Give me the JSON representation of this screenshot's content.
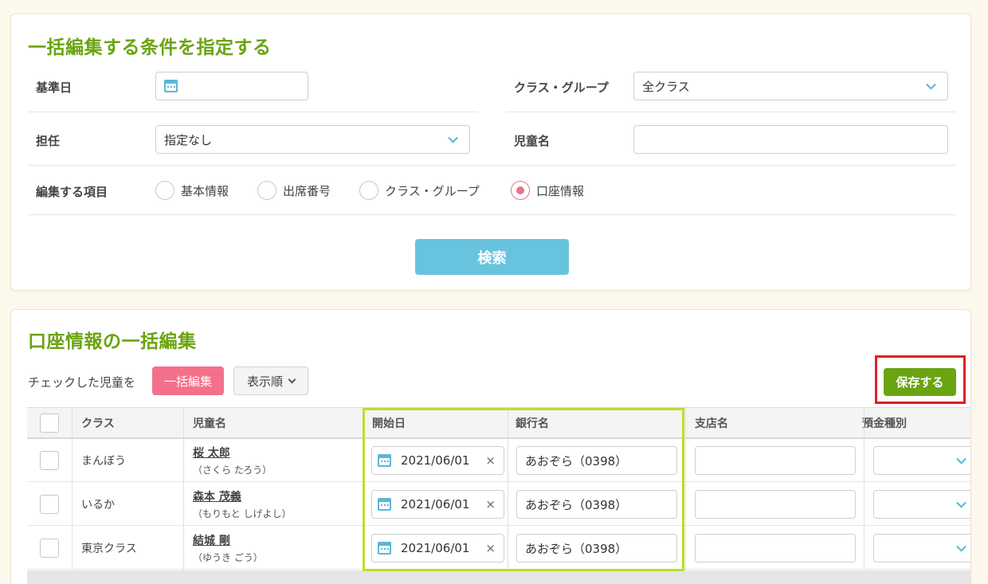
{
  "search_section": {
    "title": "一括編集する条件を指定する",
    "base_date_label": "基準日",
    "base_date_value": "",
    "class_group_label": "クラス・グループ",
    "class_group_value": "全クラス",
    "teacher_label": "担任",
    "teacher_value": "指定なし",
    "child_name_label": "児童名",
    "child_name_value": "",
    "edit_item_label": "編集する項目",
    "edit_item_options": [
      {
        "label": "基本情報",
        "checked": false
      },
      {
        "label": "出席番号",
        "checked": false
      },
      {
        "label": "クラス・グループ",
        "checked": false
      },
      {
        "label": "口座情報",
        "checked": true
      }
    ],
    "search_button": "検索"
  },
  "edit_section": {
    "title": "口座情報の一括編集",
    "checked_children_text": "チェックした児童を",
    "bulk_edit_button": "一括編集",
    "sort_button": "表示順",
    "save_button": "保存する"
  },
  "table": {
    "headers": [
      "クラス",
      "児童名",
      "開始日",
      "銀行名",
      "支店名",
      "預金種別"
    ],
    "rows": [
      {
        "class": "まんぼう",
        "name": "桜 太郎",
        "kana": "（さくら たろう）",
        "start_date": "2021/06/01",
        "bank": "あおぞら（0398）",
        "branch": "",
        "deposit_type": ""
      },
      {
        "class": "いるか",
        "name": "森本 茂義",
        "kana": "（もりもと しげよし）",
        "start_date": "2021/06/01",
        "bank": "あおぞら（0398）",
        "branch": "",
        "deposit_type": ""
      },
      {
        "class": "東京クラス",
        "name": "結城 剛",
        "kana": "（ゆうき ごう）",
        "start_date": "2021/06/01",
        "bank": "あおぞら（0398）",
        "branch": "",
        "deposit_type": ""
      }
    ]
  },
  "colors": {
    "accent_green": "#6aa411",
    "search_blue": "#68c4de",
    "pink": "#f4708a",
    "highlight_red": "#e02020",
    "highlight_lime": "#b8e02a"
  },
  "icons": [
    "calendar-icon",
    "chevron-down-icon",
    "clear-icon",
    "radio-icon",
    "checkbox-icon"
  ]
}
